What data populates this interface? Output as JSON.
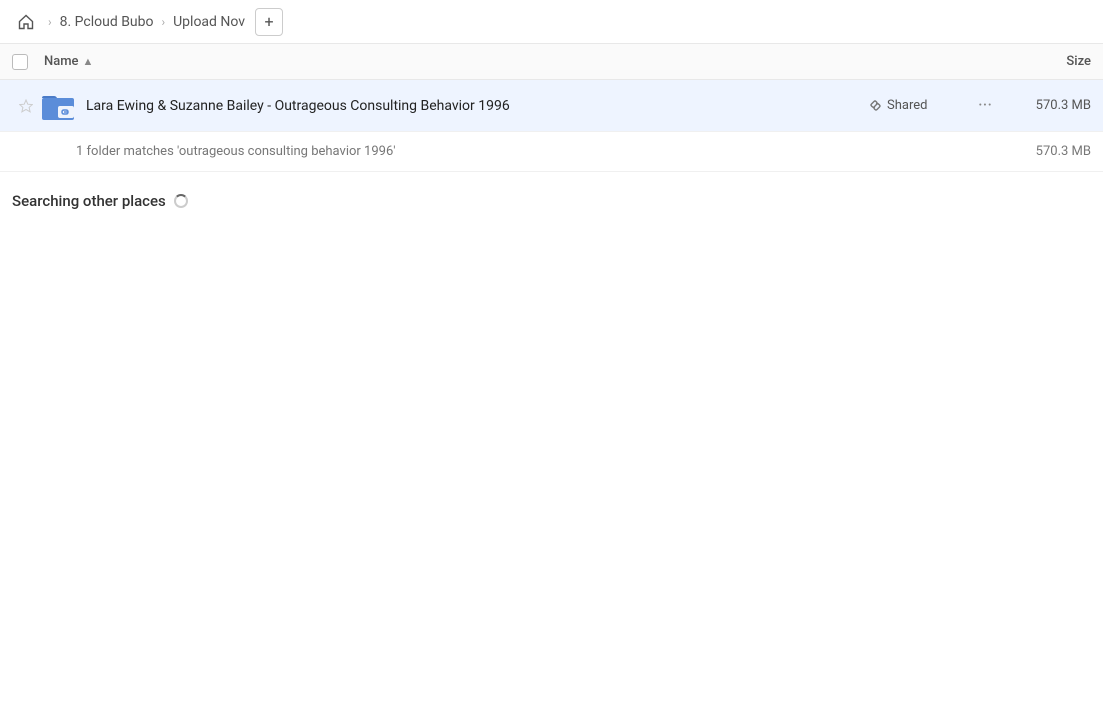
{
  "toolbar": {
    "home_label": "Home",
    "breadcrumb1": "8. Pcloud Bubo",
    "breadcrumb2": "Upload Nov",
    "add_button_label": "+"
  },
  "columns": {
    "name_label": "Name",
    "size_label": "Size",
    "sort_indicator": "▲"
  },
  "file_row": {
    "name": "Lara Ewing & Suzanne Bailey - Outrageous Consulting Behavior 1996",
    "shared_label": "Shared",
    "size": "570.3 MB",
    "more_label": "···"
  },
  "match_row": {
    "text": "1 folder matches 'outrageous consulting behavior 1996'",
    "size": "570.3 MB"
  },
  "searching_section": {
    "label": "Searching other places"
  }
}
